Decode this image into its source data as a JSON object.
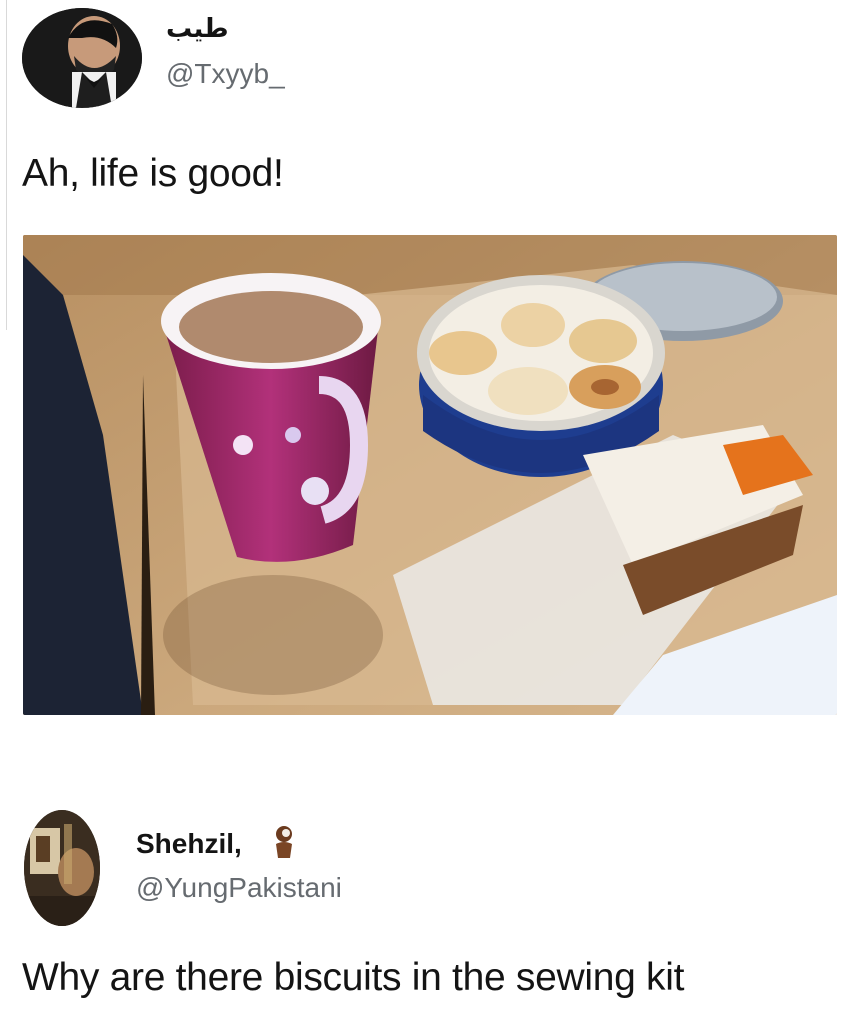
{
  "tweets": [
    {
      "display_name": "طيب",
      "handle": "@Txyyb_",
      "text": "Ah, life is good!",
      "media": {
        "icon": "photo-tea-and-biscuits"
      }
    },
    {
      "display_name": "Shehzil,",
      "handle": "@YungPakistani",
      "text": "Why are there biscuits in the sewing kit",
      "name_icon": "brown-figure-emoji-icon"
    }
  ]
}
